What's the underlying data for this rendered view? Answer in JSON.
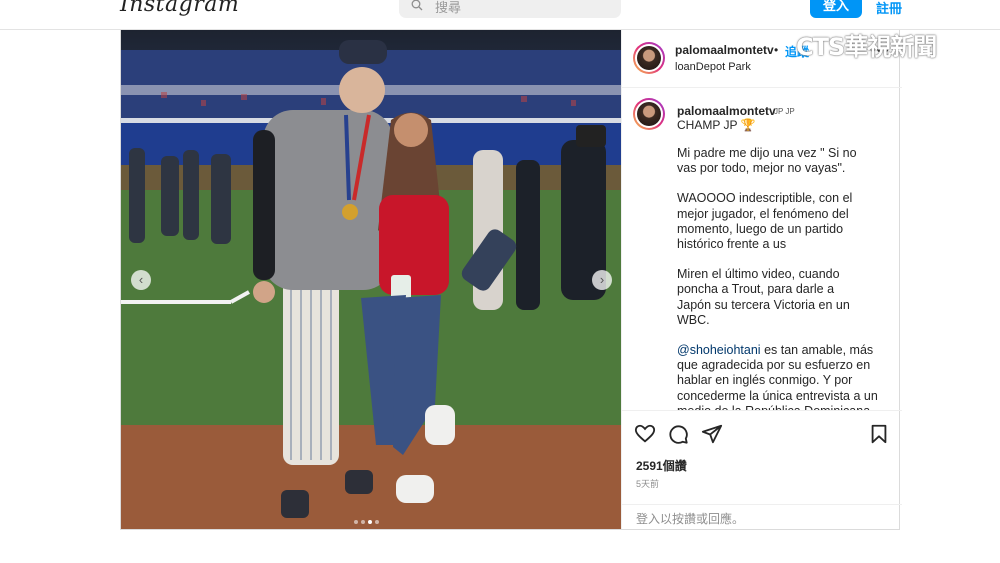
{
  "nav": {
    "logo_text": "Instagram",
    "search_placeholder": "搜尋",
    "login_label": "登入",
    "signup_label": "註冊"
  },
  "post": {
    "username": "palomaalmontetv",
    "follow_separator": "•",
    "follow_label": "追蹤",
    "location": "loanDepot Park",
    "more_icon": "more-horizontal-icon",
    "carousel": {
      "slide_count": 4,
      "active_index": 2
    },
    "caption": {
      "username": "palomaalmontetv",
      "flags": "JP JP",
      "champ": "CHAMP JP 🏆",
      "paragraphs": [
        "Mi padre me dijo una vez \" Si no\nvas por todo, mejor no vayas\".",
        "WAOOOO indescriptible, con el\nmejor jugador, el fenómeno del\nmomento, luego de un partido\nhistórico frente a us",
        "Miren el último video, cuando\nponcha a Trout, para darle a\nJapón su tercera Victoria en un\nWBC."
      ],
      "mention": "@shoheiohtani",
      "mention_text": " es tan amable, más\nque agradecida por su esfuerzo en\nhablar en inglés conmigo. Y por\nconcederme la única entrevista a un\nmedio de la República Dominicana"
    },
    "actions": [
      "heart-icon",
      "comment-icon",
      "share-icon",
      "bookmark-icon"
    ],
    "likes": "2591個讚",
    "time": "5天前",
    "comment_prompt": "登入以按讚或回應。"
  },
  "watermark": "CTS華視新聞",
  "colors": {
    "accent": "#0095f6",
    "mention": "#00376b",
    "border": "#dbdbdb"
  }
}
